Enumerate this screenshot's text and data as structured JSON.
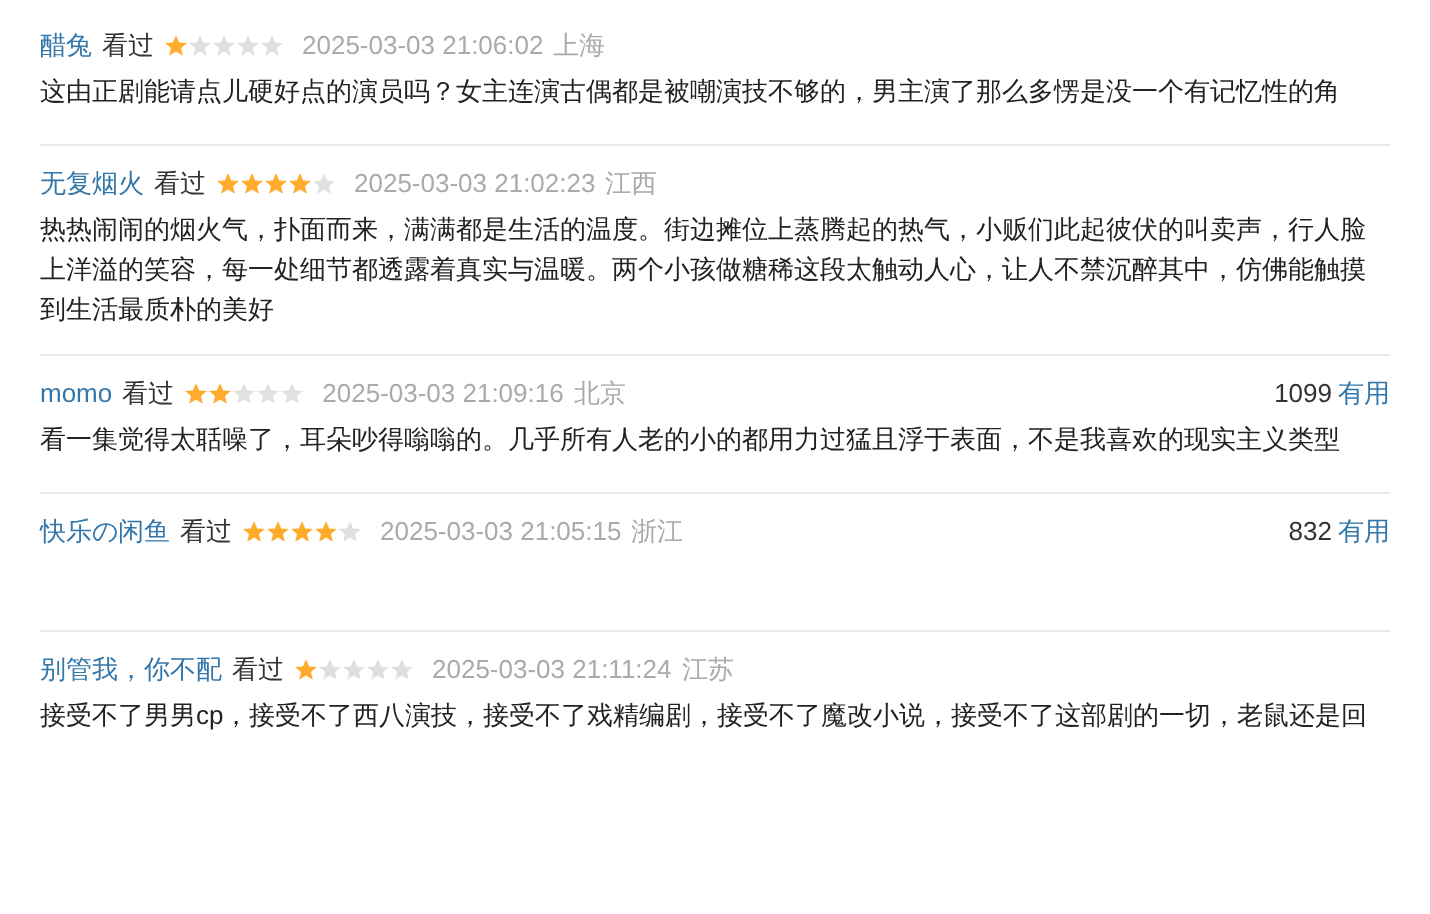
{
  "reviews": [
    {
      "user": "醋兔",
      "status": "看过",
      "stars": 1,
      "time": "2025-03-03 21:06:02",
      "location": "上海",
      "text": "这由正剧能请点儿硬好点的演员吗？女主连演古偶都是被嘲演技不够的，男主演了那么多愣是没一个有记忆性的角"
    },
    {
      "user": "无复烟火",
      "status": "看过",
      "stars": 4,
      "time": "2025-03-03 21:02:23",
      "location": "江西",
      "text": "热热闹闹的烟火气，扑面而来，满满都是生活的温度。街边摊位上蒸腾起的热气，小贩们此起彼伏的叫卖声，行人脸上洋溢的笑容，每一处细节都透露着真实与温暖。两个小孩做糖稀这段太触动人心，让人不禁沉醉其中，仿佛能触摸到生活最质朴的美好"
    },
    {
      "user": "momo",
      "status": "看过",
      "stars": 2,
      "time": "2025-03-03 21:09:16",
      "location": "北京",
      "useful_count": "1099",
      "useful_label": "有用",
      "text": "看一集觉得太聒噪了，耳朵吵得嗡嗡的。几乎所有人老的小的都用力过猛且浮于表面，不是我喜欢的现实主义类型"
    },
    {
      "user": "快乐の闲鱼",
      "status": "看过",
      "stars": 4,
      "time": "2025-03-03 21:05:15",
      "location": "浙江",
      "useful_count": "832",
      "useful_label": "有用"
    },
    {
      "user": "别管我，你不配",
      "status": "看过",
      "stars": 1,
      "time": "2025-03-03 21:11:24",
      "location": "江苏",
      "text": "接受不了男男cp，接受不了西八演技，接受不了戏精编剧，接受不了魔改小说，接受不了这部剧的一切，老鼠还是回"
    }
  ]
}
